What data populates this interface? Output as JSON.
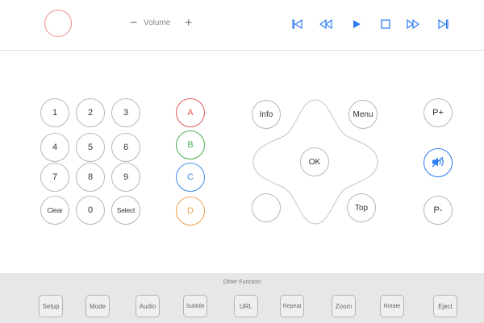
{
  "top_bar": {
    "volume": {
      "minus": "−",
      "label": "Volume",
      "plus": "+"
    },
    "transport_icons": [
      "skip-previous-icon",
      "rewind-icon",
      "play-icon",
      "stop-icon",
      "fast-forward-icon",
      "skip-next-icon"
    ]
  },
  "keypad": {
    "keys": [
      "1",
      "2",
      "3",
      "4",
      "5",
      "6",
      "7",
      "8",
      "9",
      "Clear",
      "0",
      "Select"
    ]
  },
  "color_buttons": [
    {
      "label": "A",
      "color": "#e25b5b"
    },
    {
      "label": "B",
      "color": "#4caf50"
    },
    {
      "label": "C",
      "color": "#3a8fe8"
    },
    {
      "label": "D",
      "color": "#f0a050"
    }
  ],
  "navigation": {
    "info": "Info",
    "menu": "Menu",
    "ok": "OK",
    "top": "Top"
  },
  "right_controls": {
    "page_up": "P+",
    "page_down": "P-",
    "mute_icon": "mute-speaker-icon",
    "accent": "#2d7cf0"
  },
  "other_function": {
    "title": "Other Function",
    "buttons": [
      "Setup",
      "Mode",
      "Audio",
      "Subtitle",
      "URL",
      "Repeat",
      "Zoom",
      "Rotate",
      "Eject"
    ]
  },
  "colors": {
    "power": "#f08a8a",
    "transport": "#2d7cf0",
    "footer_bg": "#e7e7e7"
  }
}
